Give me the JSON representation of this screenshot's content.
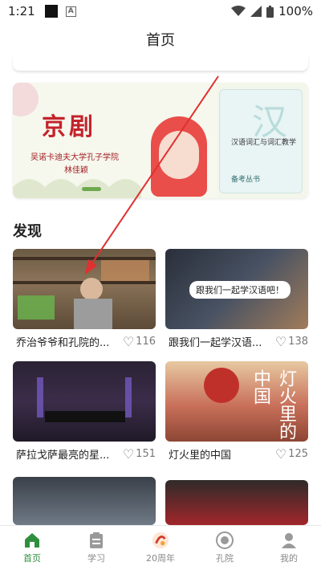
{
  "status": {
    "time": "1:21",
    "battery": "100%"
  },
  "header": {
    "title": "首页"
  },
  "banner": {
    "title": "京剧",
    "university": "吴诺卡迪夫大学孔子学院",
    "author": "林佳颖",
    "book_title": "汉语词汇与词汇教学",
    "book_series": "备考丛书"
  },
  "discover": {
    "title": "发现",
    "cards": [
      {
        "title": "乔治爷爷和孔院的...",
        "likes": "116"
      },
      {
        "title": "跟我们一起学汉语...",
        "likes": "138",
        "overlay": "跟我们一起学汉语吧！"
      },
      {
        "title": "萨拉戈萨最亮的星...",
        "likes": "151"
      },
      {
        "title": "灯火里的中国",
        "likes": "125",
        "overlay": "灯火里的中国"
      },
      {
        "title": "",
        "likes": ""
      },
      {
        "title": "",
        "likes": ""
      }
    ]
  },
  "tabbar": {
    "items": [
      {
        "label": "首页"
      },
      {
        "label": "学习"
      },
      {
        "label": "20周年"
      },
      {
        "label": "孔院"
      },
      {
        "label": "我的"
      }
    ]
  },
  "colors": {
    "accent": "#2f8f3e",
    "annotation": "#e03030"
  }
}
